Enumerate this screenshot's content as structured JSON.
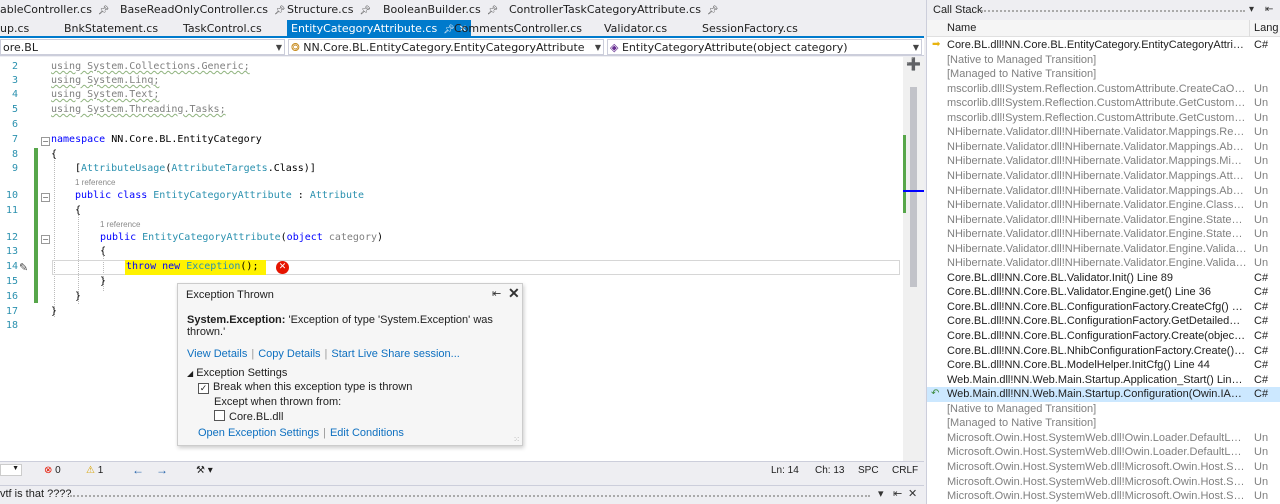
{
  "tabs": [
    {
      "label": "ableController.cs",
      "pinned": true,
      "active": false
    },
    {
      "label": "BaseReadOnlyController.cs",
      "pinned": true,
      "active": false
    },
    {
      "label": "Structure.cs",
      "pinned": true,
      "active": false
    },
    {
      "label": "BooleanBuilder.cs",
      "pinned": true,
      "active": false
    },
    {
      "label": "ControllerTaskCategoryAttribute.cs",
      "pinned": true,
      "active": false
    },
    {
      "label": "up.cs",
      "pinned": false,
      "active": false
    },
    {
      "label": "BnkStatement.cs",
      "pinned": false,
      "active": false
    },
    {
      "label": "TaskControl.cs",
      "pinned": false,
      "active": false
    },
    {
      "label": "EntityCategoryAttribute.cs",
      "pinned": true,
      "active": true
    },
    {
      "label": "CommentsController.cs",
      "pinned": false,
      "active": false
    },
    {
      "label": "Validator.cs",
      "pinned": false,
      "active": false
    },
    {
      "label": "SessionFactory.cs",
      "pinned": false,
      "active": false
    }
  ],
  "navbar": {
    "project": "ore.BL",
    "type": "NN.Core.BL.EntityCategory.EntityCategoryAttribute",
    "member": "EntityCategoryAttribute(object category)"
  },
  "code": {
    "line_numbers": [
      "2",
      "3",
      "4",
      "5",
      "6",
      "7",
      "8",
      "9",
      "10",
      "11",
      "12",
      "13",
      "14",
      "15",
      "16",
      "17",
      "18"
    ],
    "using1": "using System.Collections.Generic;",
    "using2": "using System.Linq;",
    "using3": "using System.Text;",
    "using4": "using System.Threading.Tasks;",
    "ns_kw": "namespace",
    "ns_name": " NN.Core.BL.EntityCategory",
    "brace_open": "{",
    "brace_close": "}",
    "attr_open": "[",
    "attr_usage": "AttributeUsage",
    "attr_paren": "(",
    "attr_targets": "AttributeTargets",
    "attr_class": ".Class)]",
    "ref1": "1 reference",
    "ref2": "1 reference",
    "class_kw": "public class ",
    "class_name": "EntityCategoryAttribute",
    "class_colon": " : ",
    "class_base": "Attribute",
    "ctor_kw": "public ",
    "ctor_name": "EntityCategoryAttribute",
    "ctor_paren": "(",
    "ctor_obj": "object ",
    "ctor_param": "category",
    "ctor_close": ")",
    "throw_kw": "throw new ",
    "throw_type": "Exception",
    "throw_end": "();"
  },
  "popup": {
    "title": "Exception Thrown",
    "exception_type": "System.Exception:",
    "exception_message": " 'Exception of type 'System.Exception' was thrown.'",
    "link_view": "View Details",
    "link_copy": "Copy Details",
    "link_share": "Start Live Share session...",
    "settings_header": "Exception Settings",
    "break_label": "Break when this exception type is thrown",
    "except_label": "Except when thrown from:",
    "module_label": "Core.BL.dll",
    "link_open_settings": "Open Exception Settings",
    "link_edit_conditions": "Edit Conditions"
  },
  "statusbar": {
    "errors": "0",
    "warnings": "1",
    "line": "Ln: 14",
    "col": "Ch: 13",
    "spc": "SPC",
    "eol": "CRLF"
  },
  "bottom_panel": {
    "title": "vtf is that ????"
  },
  "callstack": {
    "title": "Call Stack",
    "col_name": "Name",
    "col_lang": "Lang",
    "rows": [
      {
        "name": "Core.BL.dll!NN.Core.BL.EntityCategory.EntityCategoryAttribute.En...",
        "lang": "C#",
        "ext": false,
        "current": true
      },
      {
        "name": "[Native to Managed Transition]",
        "lang": "",
        "ext": true
      },
      {
        "name": "[Managed to Native Transition]",
        "lang": "",
        "ext": true
      },
      {
        "name": "mscorlib.dll!System.Reflection.CustomAttribute.CreateCaObject(S...",
        "lang": "Un",
        "ext": true
      },
      {
        "name": "mscorlib.dll!System.Reflection.CustomAttribute.GetCustomAttrib...",
        "lang": "Un",
        "ext": true
      },
      {
        "name": "mscorlib.dll!System.Reflection.CustomAttribute.GetCustomAttrib...",
        "lang": "Un",
        "ext": true
      },
      {
        "name": "NHibernate.Validator.dll!NHibernate.Validator.Mappings.Reflecti...",
        "lang": "Un",
        "ext": true
      },
      {
        "name": "NHibernate.Validator.dll!NHibernate.Validator.Mappings.Abstrac...",
        "lang": "Un",
        "ext": true
      },
      {
        "name": "NHibernate.Validator.dll!NHibernate.Validator.Mappings.MixedCl...",
        "lang": "Un",
        "ext": true
      },
      {
        "name": "NHibernate.Validator.dll!NHibernate.Validator.Mappings.Attribut...",
        "lang": "Un",
        "ext": true
      },
      {
        "name": "NHibernate.Validator.dll!NHibernate.Validator.Mappings.Abstrac...",
        "lang": "Un",
        "ext": true
      },
      {
        "name": "NHibernate.Validator.dll!NHibernate.Validator.Engine.ClassValida...",
        "lang": "Un",
        "ext": true
      },
      {
        "name": "NHibernate.Validator.dll!NHibernate.Validator.Engine.StateFullCl...",
        "lang": "Un",
        "ext": true
      },
      {
        "name": "NHibernate.Validator.dll!NHibernate.Validator.Engine.StateFullCl...",
        "lang": "Un",
        "ext": true
      },
      {
        "name": "NHibernate.Validator.dll!NHibernate.Validator.Engine.ValidatorE...",
        "lang": "Un",
        "ext": true
      },
      {
        "name": "NHibernate.Validator.dll!NHibernate.Validator.Engine.ValidatorE...",
        "lang": "Un",
        "ext": true
      },
      {
        "name": "Core.BL.dll!NN.Core.BL.Validator.Init() Line 89",
        "lang": "C#",
        "ext": false
      },
      {
        "name": "Core.BL.dll!NN.Core.BL.Validator.Engine.get() Line 36",
        "lang": "C#",
        "ext": false
      },
      {
        "name": "Core.BL.dll!NN.Core.BL.ConfigurationFactory.CreateCfg() Line 501",
        "lang": "C#",
        "ext": false
      },
      {
        "name": "Core.BL.dll!NN.Core.BL.ConfigurationFactory.GetDetailedConfigur...",
        "lang": "C#",
        "ext": false
      },
      {
        "name": "Core.BL.dll!NN.Core.BL.ConfigurationFactory.Create(object instan...",
        "lang": "C#",
        "ext": false
      },
      {
        "name": "Core.BL.dll!NN.Core.BL.NhibConfigurationFactory.Create() Line 599",
        "lang": "C#",
        "ext": false
      },
      {
        "name": "Core.BL.dll!NN.Core.BL.ModelHelper.InitCfg() Line 44",
        "lang": "C#",
        "ext": false
      },
      {
        "name": "Web.Main.dll!NN.Web.Main.Startup.Application_Start() Line 105",
        "lang": "C#",
        "ext": false
      },
      {
        "name": "Web.Main.dll!NN.Web.Main.Startup.Configuration(Owin.IAppBuil...",
        "lang": "C#",
        "ext": false,
        "selected": true
      },
      {
        "name": "[Native to Managed Transition]",
        "lang": "",
        "ext": true
      },
      {
        "name": "[Managed to Native Transition]",
        "lang": "",
        "ext": true
      },
      {
        "name": "Microsoft.Owin.Host.SystemWeb.dll!Owin.Loader.DefaultLoader....",
        "lang": "Un",
        "ext": true
      },
      {
        "name": "Microsoft.Owin.Host.SystemWeb.dll!Owin.Loader.DefaultLoader.L...",
        "lang": "Un",
        "ext": true
      },
      {
        "name": "Microsoft.Owin.Host.SystemWeb.dll!Microsoft.Owin.Host.System...",
        "lang": "Un",
        "ext": true
      },
      {
        "name": "Microsoft.Owin.Host.SystemWeb.dll!Microsoft.Owin.Host.System...",
        "lang": "Un",
        "ext": true
      },
      {
        "name": "Microsoft.Owin.Host.SystemWeb.dll!Microsoft.Owin.Host.System...",
        "lang": "Un",
        "ext": true
      }
    ]
  },
  "colors": {
    "accent": "#007acc",
    "error": "#e51400",
    "throw_highlight": "#fff200",
    "change_bar": "#57a64a"
  }
}
